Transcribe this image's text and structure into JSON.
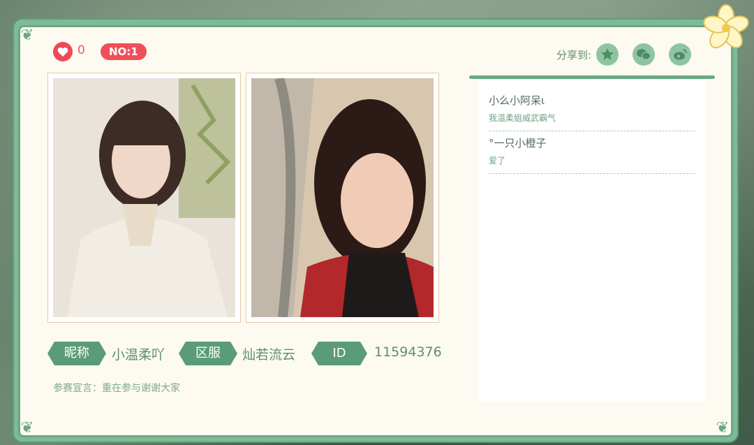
{
  "header": {
    "like_count": "0",
    "rank": "NO:1",
    "share_label": "分享到:",
    "share_targets": [
      "qzone-icon",
      "wechat-icon",
      "weibo-icon"
    ]
  },
  "profile": {
    "nickname_label": "昵称",
    "nickname": "小温柔吖",
    "server_label": "区服",
    "server": "灿若流云",
    "id_label": "ID",
    "id": "11594376",
    "declaration": "参赛宣言：重在参与谢谢大家"
  },
  "photos": [
    "selfie-photo-1",
    "selfie-photo-2"
  ],
  "comments": [
    {
      "name": "小么小阿呆ι",
      "text": "我温柔姐威武霸气"
    },
    {
      "name": "°一只小橙子",
      "text": "爱了"
    }
  ],
  "colors": {
    "accent_green": "#5b9c78",
    "like_red": "#ee4a55",
    "panel_bg": "#fdfaf1"
  }
}
